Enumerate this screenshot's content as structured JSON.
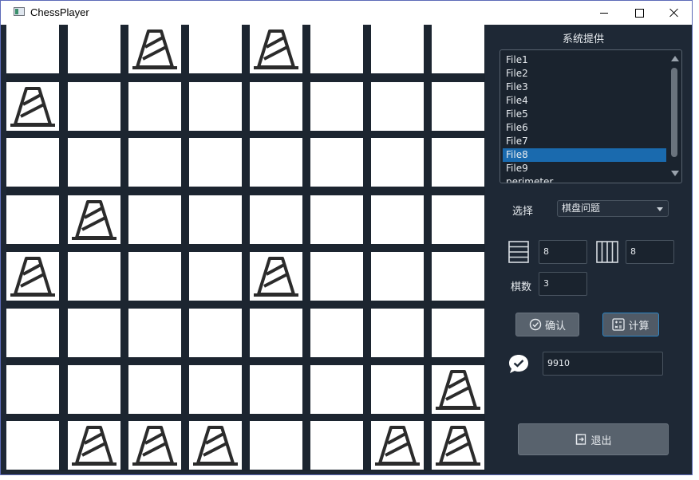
{
  "window": {
    "title": "ChessPlayer",
    "accent": "#1a6aae"
  },
  "board": {
    "rows": 8,
    "cols": 8,
    "piece_icon": "traffic-cone-icon",
    "pieces": [
      [
        0,
        2
      ],
      [
        0,
        4
      ],
      [
        1,
        0
      ],
      [
        3,
        1
      ],
      [
        4,
        0
      ],
      [
        4,
        4
      ],
      [
        6,
        7
      ],
      [
        7,
        1
      ],
      [
        7,
        2
      ],
      [
        7,
        3
      ],
      [
        7,
        6
      ],
      [
        7,
        7
      ]
    ]
  },
  "panel": {
    "title": "系统提供",
    "files": [
      "File1",
      "File2",
      "File3",
      "File4",
      "File5",
      "File6",
      "File7",
      "File8",
      "File9",
      "perimeter"
    ],
    "selected_index": 7,
    "select_label": "选择",
    "select_value": "棋盘问题",
    "rows_value": "8",
    "cols_value": "8",
    "count_label": "棋数",
    "count_value": "3",
    "confirm_label": "确认",
    "calc_label": "计算",
    "result_value": "9910",
    "exit_label": "退出"
  }
}
